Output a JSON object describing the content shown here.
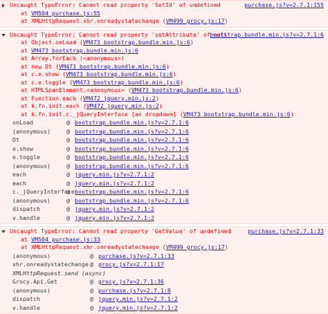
{
  "messages": [
    {
      "title": "Uncaught TypeError: Cannot read property 'SetId' of undefined",
      "source": "purchase.js?v=2.7.1:155",
      "stack": [
        {
          "prefix": "at ",
          "link": "VM504 purchase.js:55",
          "suffix": ""
        },
        {
          "prefix": "at XMLHttpRequest.xhr.onreadystatechange (",
          "link": "VM499 grocy.js:17",
          "suffix": ")"
        }
      ]
    },
    {
      "title": "Uncaught TypeError: Cannot read property 'setAttribute' of null",
      "source": "bootstrap.bundle.min.js?v=2.7.1:6",
      "stack": [
        {
          "prefix": "at Object.onLoad (",
          "link": "VM473 bootstrap.bundle.min.js:6",
          "suffix": ")"
        },
        {
          "prefix": "at ",
          "link": "VM473 bootstrap.bundle.min.js:6",
          "suffix": ""
        },
        {
          "prefix": "at Array.forEach (<anonymous>)",
          "link": "",
          "suffix": ""
        },
        {
          "prefix": "at new Dt (",
          "link": "VM473 bootstrap.bundle.min.js:6",
          "suffix": ")"
        },
        {
          "prefix": "at c.e.show (",
          "link": "VM473 bootstrap.bundle.min.js:6",
          "suffix": ")"
        },
        {
          "prefix": "at c.e.toggle (",
          "link": "VM473 bootstrap.bundle.min.js:6",
          "suffix": ")"
        },
        {
          "prefix": "at HTMLSpanElement.<anonymous> (",
          "link": "VM473 bootstrap.bundle.min.js:6",
          "suffix": ")"
        },
        {
          "prefix": "at Function.each (",
          "link": "VM472 jquery.min.js:2",
          "suffix": ")"
        },
        {
          "prefix": "at k.fn.init.each (",
          "link": "VM472 jquery.min.js:2",
          "suffix": ")"
        },
        {
          "prefix": "at k.fn.init.c._jQueryInterface [as dropdown] (",
          "link": "VM473 bootstrap.bundle.min.js:6",
          "suffix": ")"
        }
      ],
      "trace": [
        {
          "fn": "onLoad",
          "link": "bootstrap.bundle.min.js?v=2.7.1:6"
        },
        {
          "fn": "(anonymous)",
          "link": "bootstrap.bundle.min.js?v=2.7.1:6"
        },
        {
          "fn": "Dt",
          "link": "bootstrap.bundle.min.js?v=2.7.1:6"
        },
        {
          "fn": "e.show",
          "link": "bootstrap.bundle.min.js?v=2.7.1:6"
        },
        {
          "fn": "e.toggle",
          "link": "bootstrap.bundle.min.js?v=2.7.1:6"
        },
        {
          "fn": "(anonymous)",
          "link": "bootstrap.bundle.min.js?v=2.7.1:6"
        },
        {
          "fn": "each",
          "link": "jquery.min.js?v=2.7.1:2"
        },
        {
          "fn": "each",
          "link": "jquery.min.js?v=2.7.1:2"
        },
        {
          "fn": "c._jQueryInterface",
          "link": "bootstrap.bundle.min.js?v=2.7.1:6"
        },
        {
          "fn": "(anonymous)",
          "link": "bootstrap.bundle.min.js?v=2.7.1:6"
        },
        {
          "fn": "dispatch",
          "link": "jquery.min.js?v=2.7.1:2"
        },
        {
          "fn": "v.handle",
          "link": "jquery.min.js?v=2.7.1:2"
        }
      ]
    },
    {
      "title": "Uncaught TypeError: Cannot read property 'GetValue' of undefined",
      "source": "purchase.js?v=2.7.1:33",
      "stack": [
        {
          "prefix": "at ",
          "link": "VM504 purchase.js:33",
          "suffix": ""
        },
        {
          "prefix": "at XMLHttpRequest.xhr.onreadystatechange (",
          "link": "VM499 grocy.js:17",
          "suffix": ")"
        }
      ],
      "trace": [
        {
          "fn": "(anonymous)",
          "link": "purchase.js?v=2.7.1:33"
        },
        {
          "fn": "xhr.onreadystatechange",
          "link": "grocy.js?v=2.7.1:17"
        },
        {
          "fn": "XMLHttpRequest.send (async)",
          "link": "",
          "italic": true
        },
        {
          "fn": "Grocy.Api.Get",
          "link": "grocy.js?v=2.7.1:36"
        },
        {
          "fn": "(anonymous)",
          "link": "purchase.js?v=2.7.1:8"
        },
        {
          "fn": "dispatch",
          "link": "jquery.min.js?v=2.7.1:2"
        },
        {
          "fn": "v.handle",
          "link": "jquery.min.js?v=2.7.1:2"
        }
      ]
    }
  ],
  "colors": {
    "error_text": "#ff0000",
    "error_bg": "#fff0f0",
    "link": "#1a1aa6"
  },
  "icons": {
    "collapsed": "triangle-right-icon",
    "expanded": "triangle-down-icon"
  }
}
